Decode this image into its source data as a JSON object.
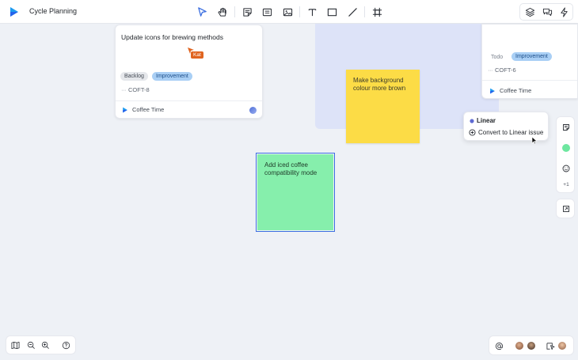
{
  "app": {
    "title": "Cycle Planning"
  },
  "toolbar": {
    "tools": [
      "pointer-tool",
      "hand-tool",
      "sticky-note-tool",
      "card-tool",
      "image-tool",
      "text-tool",
      "rectangle-tool",
      "line-tool",
      "frame-tool"
    ],
    "right_tools": [
      "layers-icon",
      "comments-icon",
      "lightning-icon"
    ]
  },
  "cards": [
    {
      "title": "Update icons for brewing methods",
      "tags": [
        "Backlog",
        "Improvement"
      ],
      "id": "COFT-8",
      "team": "Coffee Time"
    },
    {
      "title": "",
      "tags": [
        "Todo",
        "Improvement"
      ],
      "id": "COFT-6",
      "team": "Coffee Time"
    }
  ],
  "cursor": {
    "user": "Kat",
    "color": "#e06420"
  },
  "stickies": [
    {
      "text": "Make background colour more brown",
      "color": "#fcdc46"
    },
    {
      "text": "Add iced coffee compatibility mode",
      "color": "#86efac",
      "selected": true
    }
  ],
  "popup": {
    "header": "Linear",
    "item": "Convert to Linear issue"
  },
  "side_toolbar": {
    "reaction_count": "+1",
    "selected_color": "#6ee7a0"
  },
  "colors": {
    "canvas": "#eef1f6",
    "accent": "#3b6ee0",
    "tag_blue": "#a9cff5",
    "frame_bg": "#dde3f8"
  }
}
